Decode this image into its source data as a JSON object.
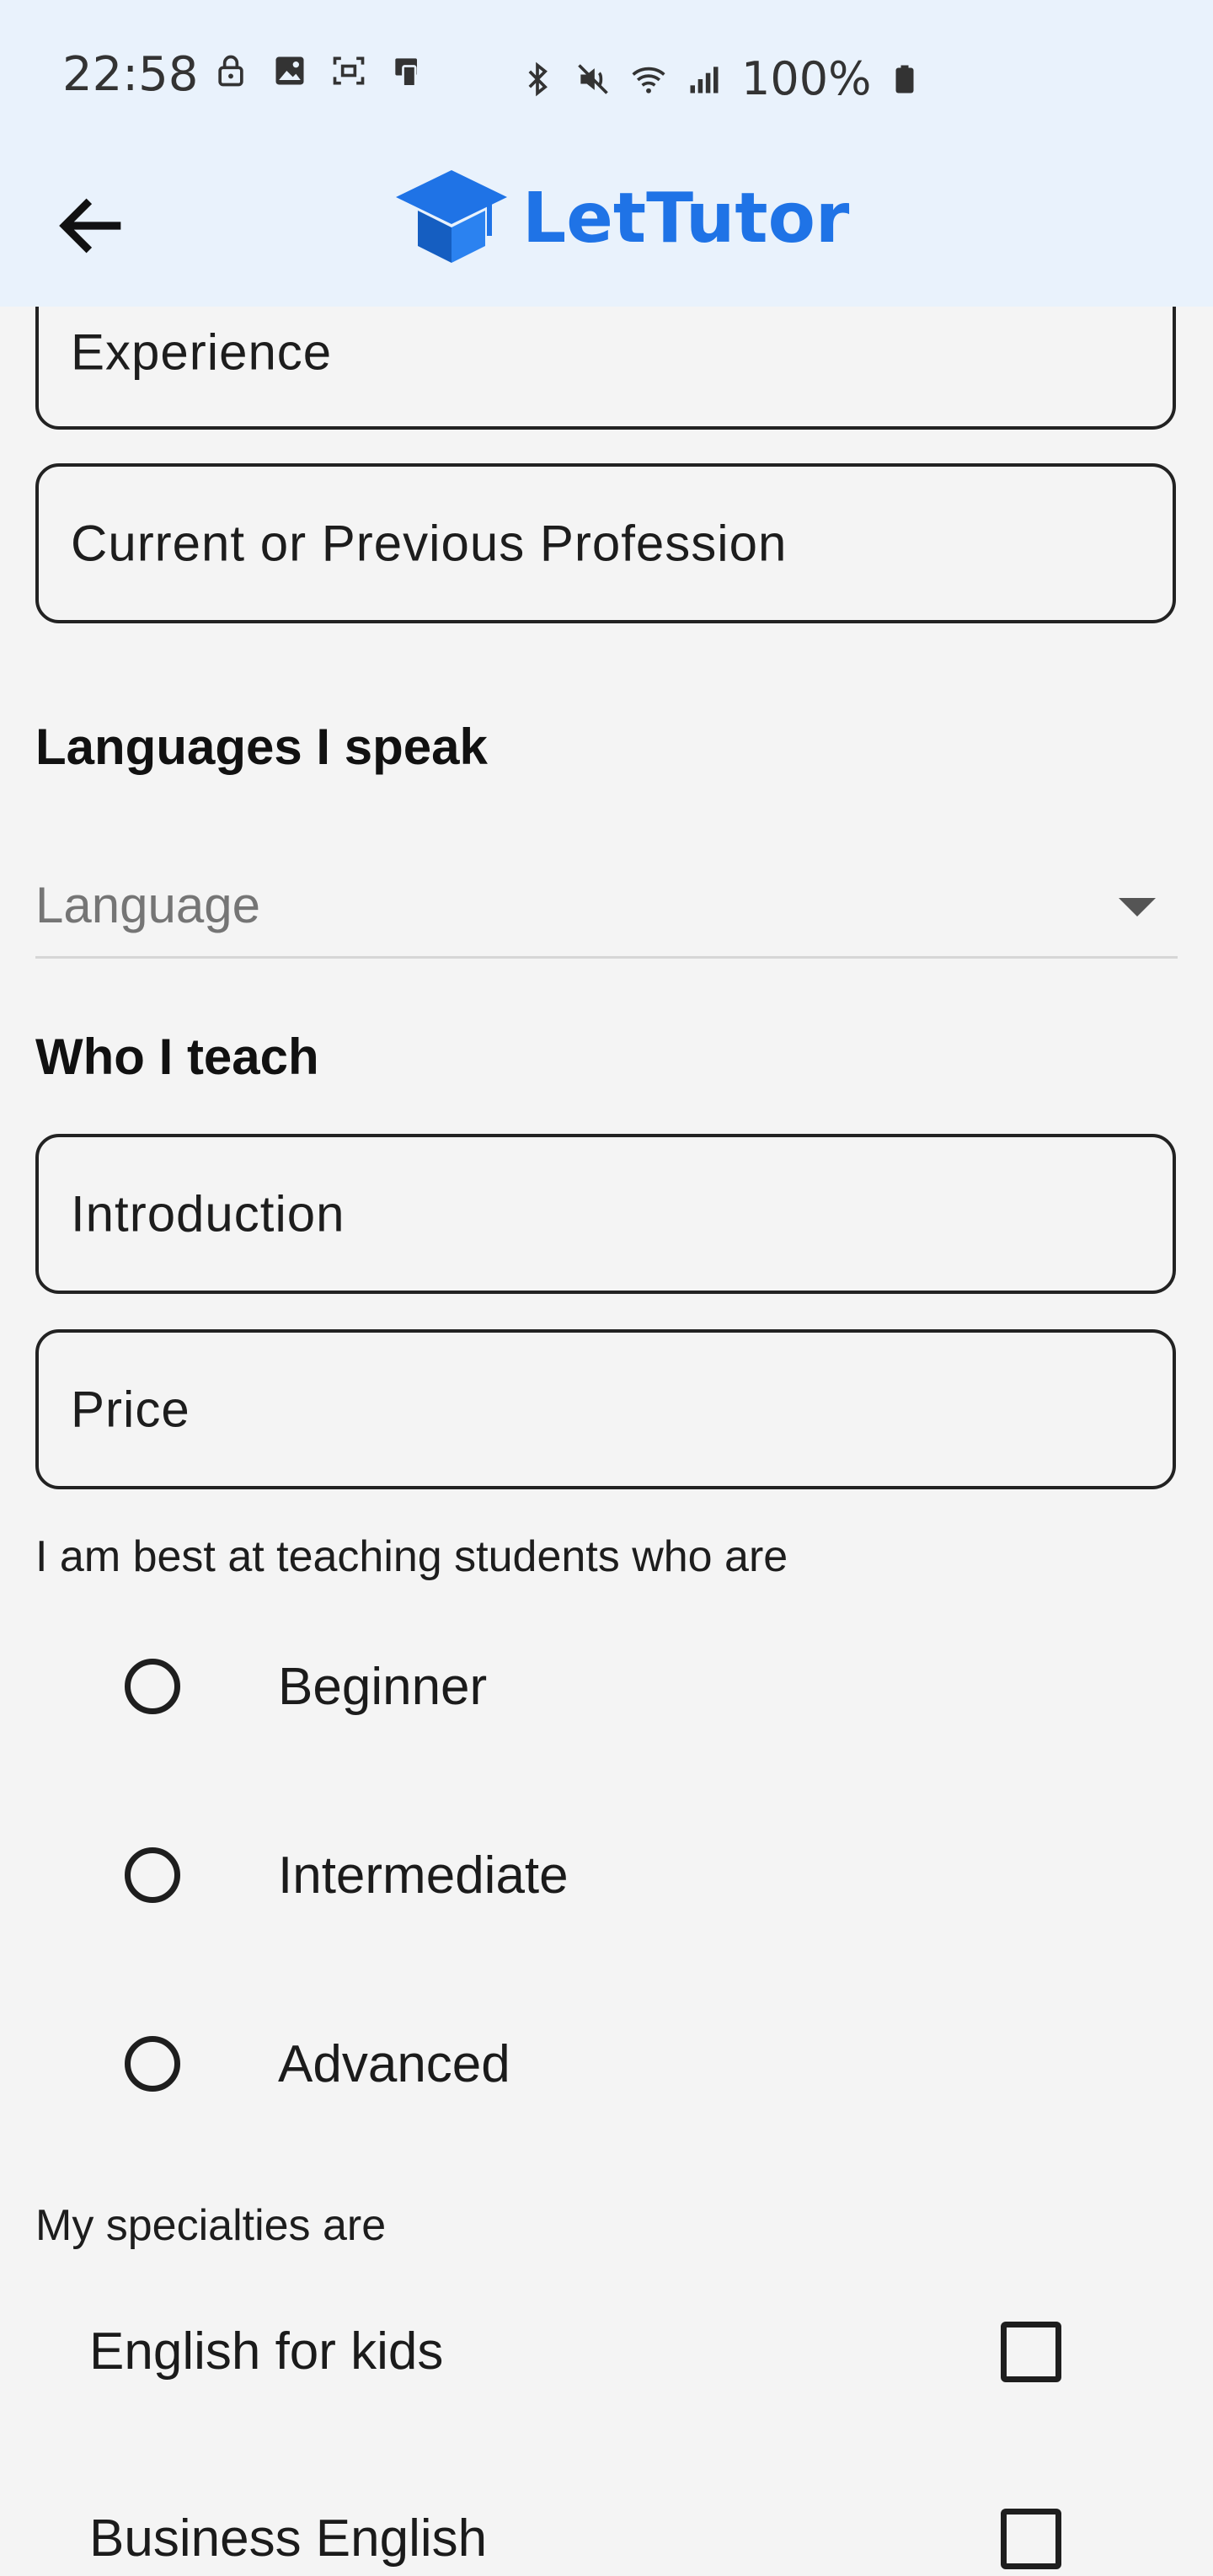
{
  "status_bar": {
    "time": "22:58",
    "battery": "100%",
    "icons_left": [
      "lock-icon",
      "image-icon",
      "screenshot-icon",
      "cast-icon"
    ],
    "icons_right": [
      "bluetooth-icon",
      "mute-icon",
      "wifi-icon",
      "signal-icon",
      "battery-icon"
    ]
  },
  "app_bar": {
    "back_icon": "arrow-left-icon",
    "logo_icon": "graduation-cap-icon",
    "logo_text": "LetTutor",
    "brand_color": "#1f73e6"
  },
  "form": {
    "experience_placeholder": "Experience",
    "profession_placeholder": "Current or Previous Profession",
    "languages_title": "Languages I speak",
    "language_placeholder": "Language",
    "who_teach_title": "Who I teach",
    "introduction_placeholder": "Introduction",
    "price_placeholder": "Price",
    "best_at_label": "I am best at teaching students who are",
    "levels": [
      "Beginner",
      "Intermediate",
      "Advanced"
    ],
    "specialties_label": "My specialties are",
    "specialties": [
      "English for kids",
      "Business English"
    ]
  }
}
